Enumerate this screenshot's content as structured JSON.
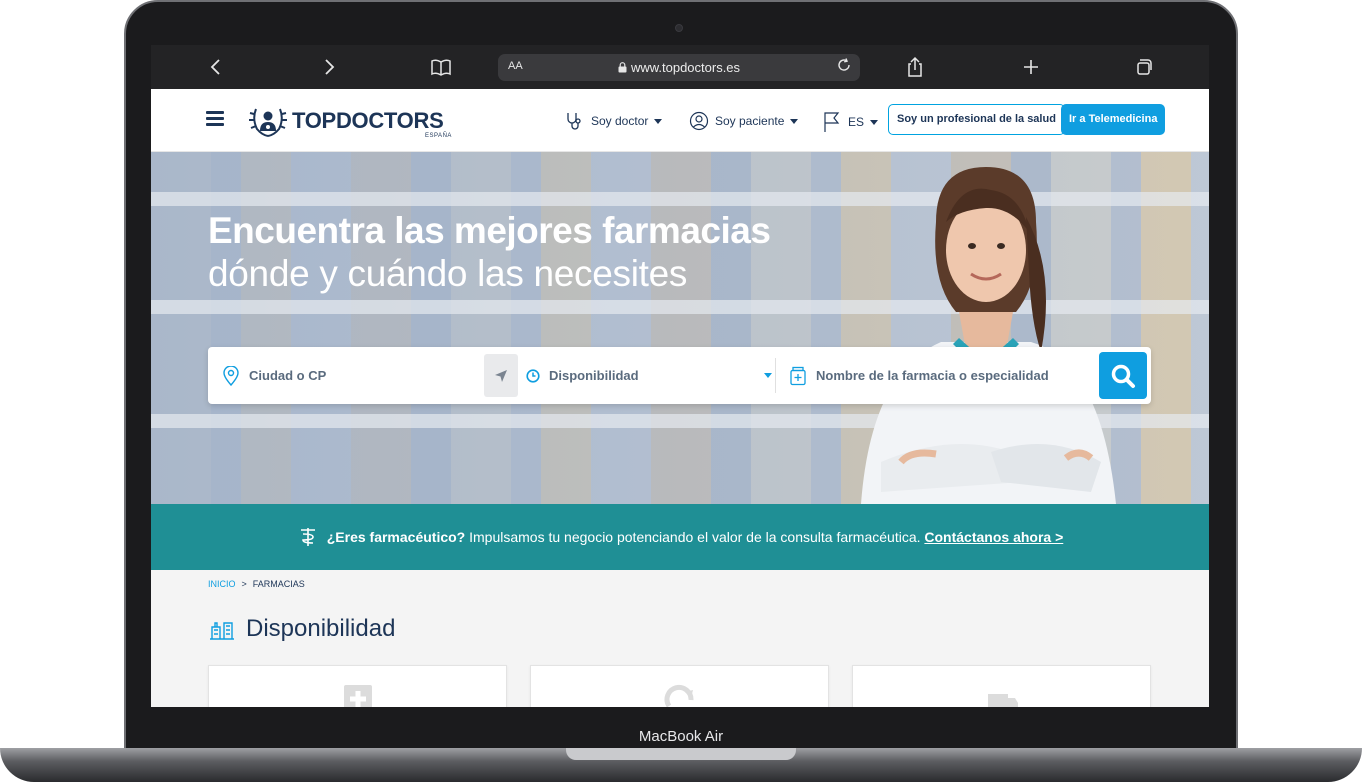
{
  "device": {
    "label": "MacBook Air"
  },
  "browser": {
    "url": "www.topdoctors.es",
    "text_size_label": "AA"
  },
  "site": {
    "logo": {
      "top": "TOP",
      "doctors": "DOCTORS",
      "country": "ESPAÑA"
    },
    "nav": {
      "doctor": "Soy doctor",
      "patient": "Soy paciente",
      "language": "ES"
    },
    "cta_professional": "Soy un profesional de la salud",
    "cta_telemedicine": "Ir a Telemedicina"
  },
  "hero": {
    "title_line1": "Encuentra las mejores farmacias",
    "title_line2": "dónde y cuándo las necesites"
  },
  "search": {
    "location_placeholder": "Ciudad o CP",
    "availability_label": "Disponibilidad",
    "name_placeholder": "Nombre de la farmacia o especialidad"
  },
  "banner": {
    "question": "¿Eres farmacéutico?",
    "text": " Impulsamos tu negocio potenciando el valor de la consulta farmacéutica. ",
    "link": "Contáctanos ahora >"
  },
  "breadcrumb": {
    "home": "INICIO",
    "separator": ">",
    "current": "FARMACIAS"
  },
  "section": {
    "title": "Disponibilidad"
  },
  "colors": {
    "primary": "#0f9ee0",
    "navy": "#1d3557",
    "teal": "#1f8f95"
  }
}
